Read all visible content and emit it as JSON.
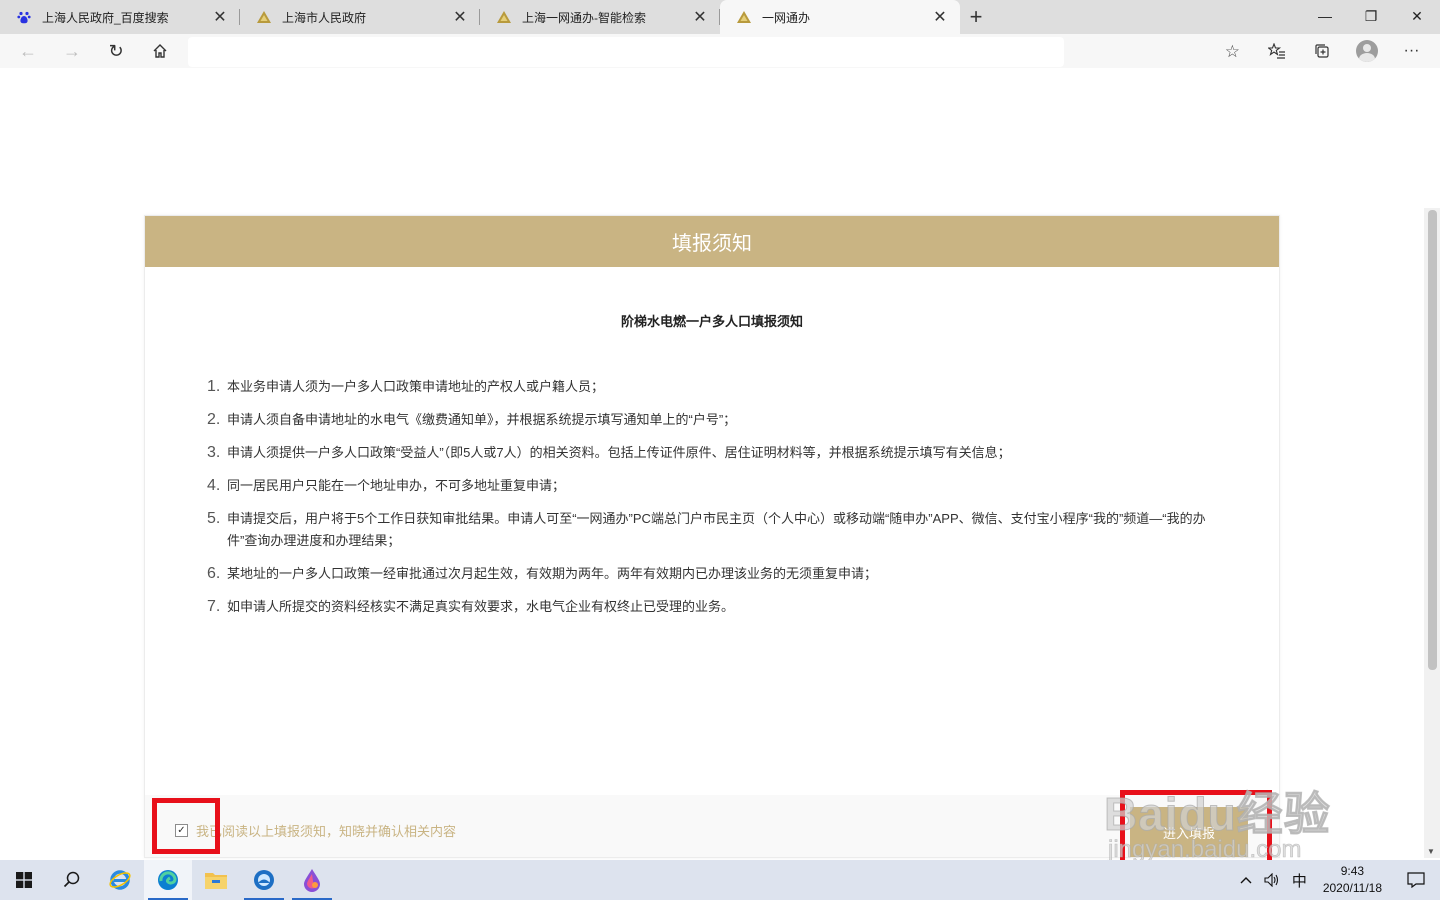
{
  "browser": {
    "tabs": [
      {
        "title": "上海人民政府_百度搜索",
        "favicon": "baidu-paw-icon",
        "active": false
      },
      {
        "title": "上海市人民政府",
        "favicon": "gov-emblem-icon",
        "active": false
      },
      {
        "title": "上海一网通办-智能检索",
        "favicon": "gov-emblem-icon",
        "active": false
      },
      {
        "title": "一网通办",
        "favicon": "gov-emblem-icon",
        "active": true
      }
    ],
    "new_tab_label": "+",
    "address_value": ""
  },
  "page": {
    "header_title": "填报须知",
    "notice_title": "阶梯水电燃一户多人口填报须知",
    "items": [
      {
        "num": "1.",
        "text": "本业务申请人须为一户多人口政策申请地址的产权人或户籍人员；"
      },
      {
        "num": "2.",
        "text": "申请人须自备申请地址的水电气《缴费通知单》，并根据系统提示填写通知单上的“户号”；"
      },
      {
        "num": "3.",
        "text": "申请人须提供一户多人口政策“受益人”（即5人或7人）的相关资料。包括上传证件原件、居住证明材料等，并根据系统提示填写有关信息；"
      },
      {
        "num": "4.",
        "text": "同一居民用户只能在一个地址申办，不可多地址重复申请；"
      },
      {
        "num": "5.",
        "text": "申请提交后，用户将于5个工作日获知审批结果。申请人可至“一网通办”PC端总门户市民主页（个人中心）或移动端“随申办”APP、微信、支付宝小程序“我的”频道—“我的办件”查询办理进度和办理结果；"
      },
      {
        "num": "6.",
        "text": "某地址的一户多人口政策一经审批通过次月起生效，有效期为两年。两年有效期内已办理该业务的无须重复申请；"
      },
      {
        "num": "7.",
        "text": "如申请人所提交的资料经核实不满足真实有效要求，水电气企业有权终止已受理的业务。"
      }
    ],
    "agree_label": "我已阅读以上填报须知，知晓并确认相关内容",
    "agree_checked": true,
    "enter_button": "进入填报"
  },
  "watermark": {
    "top": "Baidu经验",
    "bottom": "jingyan.baidu.com"
  },
  "taskbar": {
    "ime": "中",
    "time": "9:43",
    "date": "2020/11/18"
  },
  "colors": {
    "accent": "#c9b483",
    "highlight": "#e8101a"
  }
}
